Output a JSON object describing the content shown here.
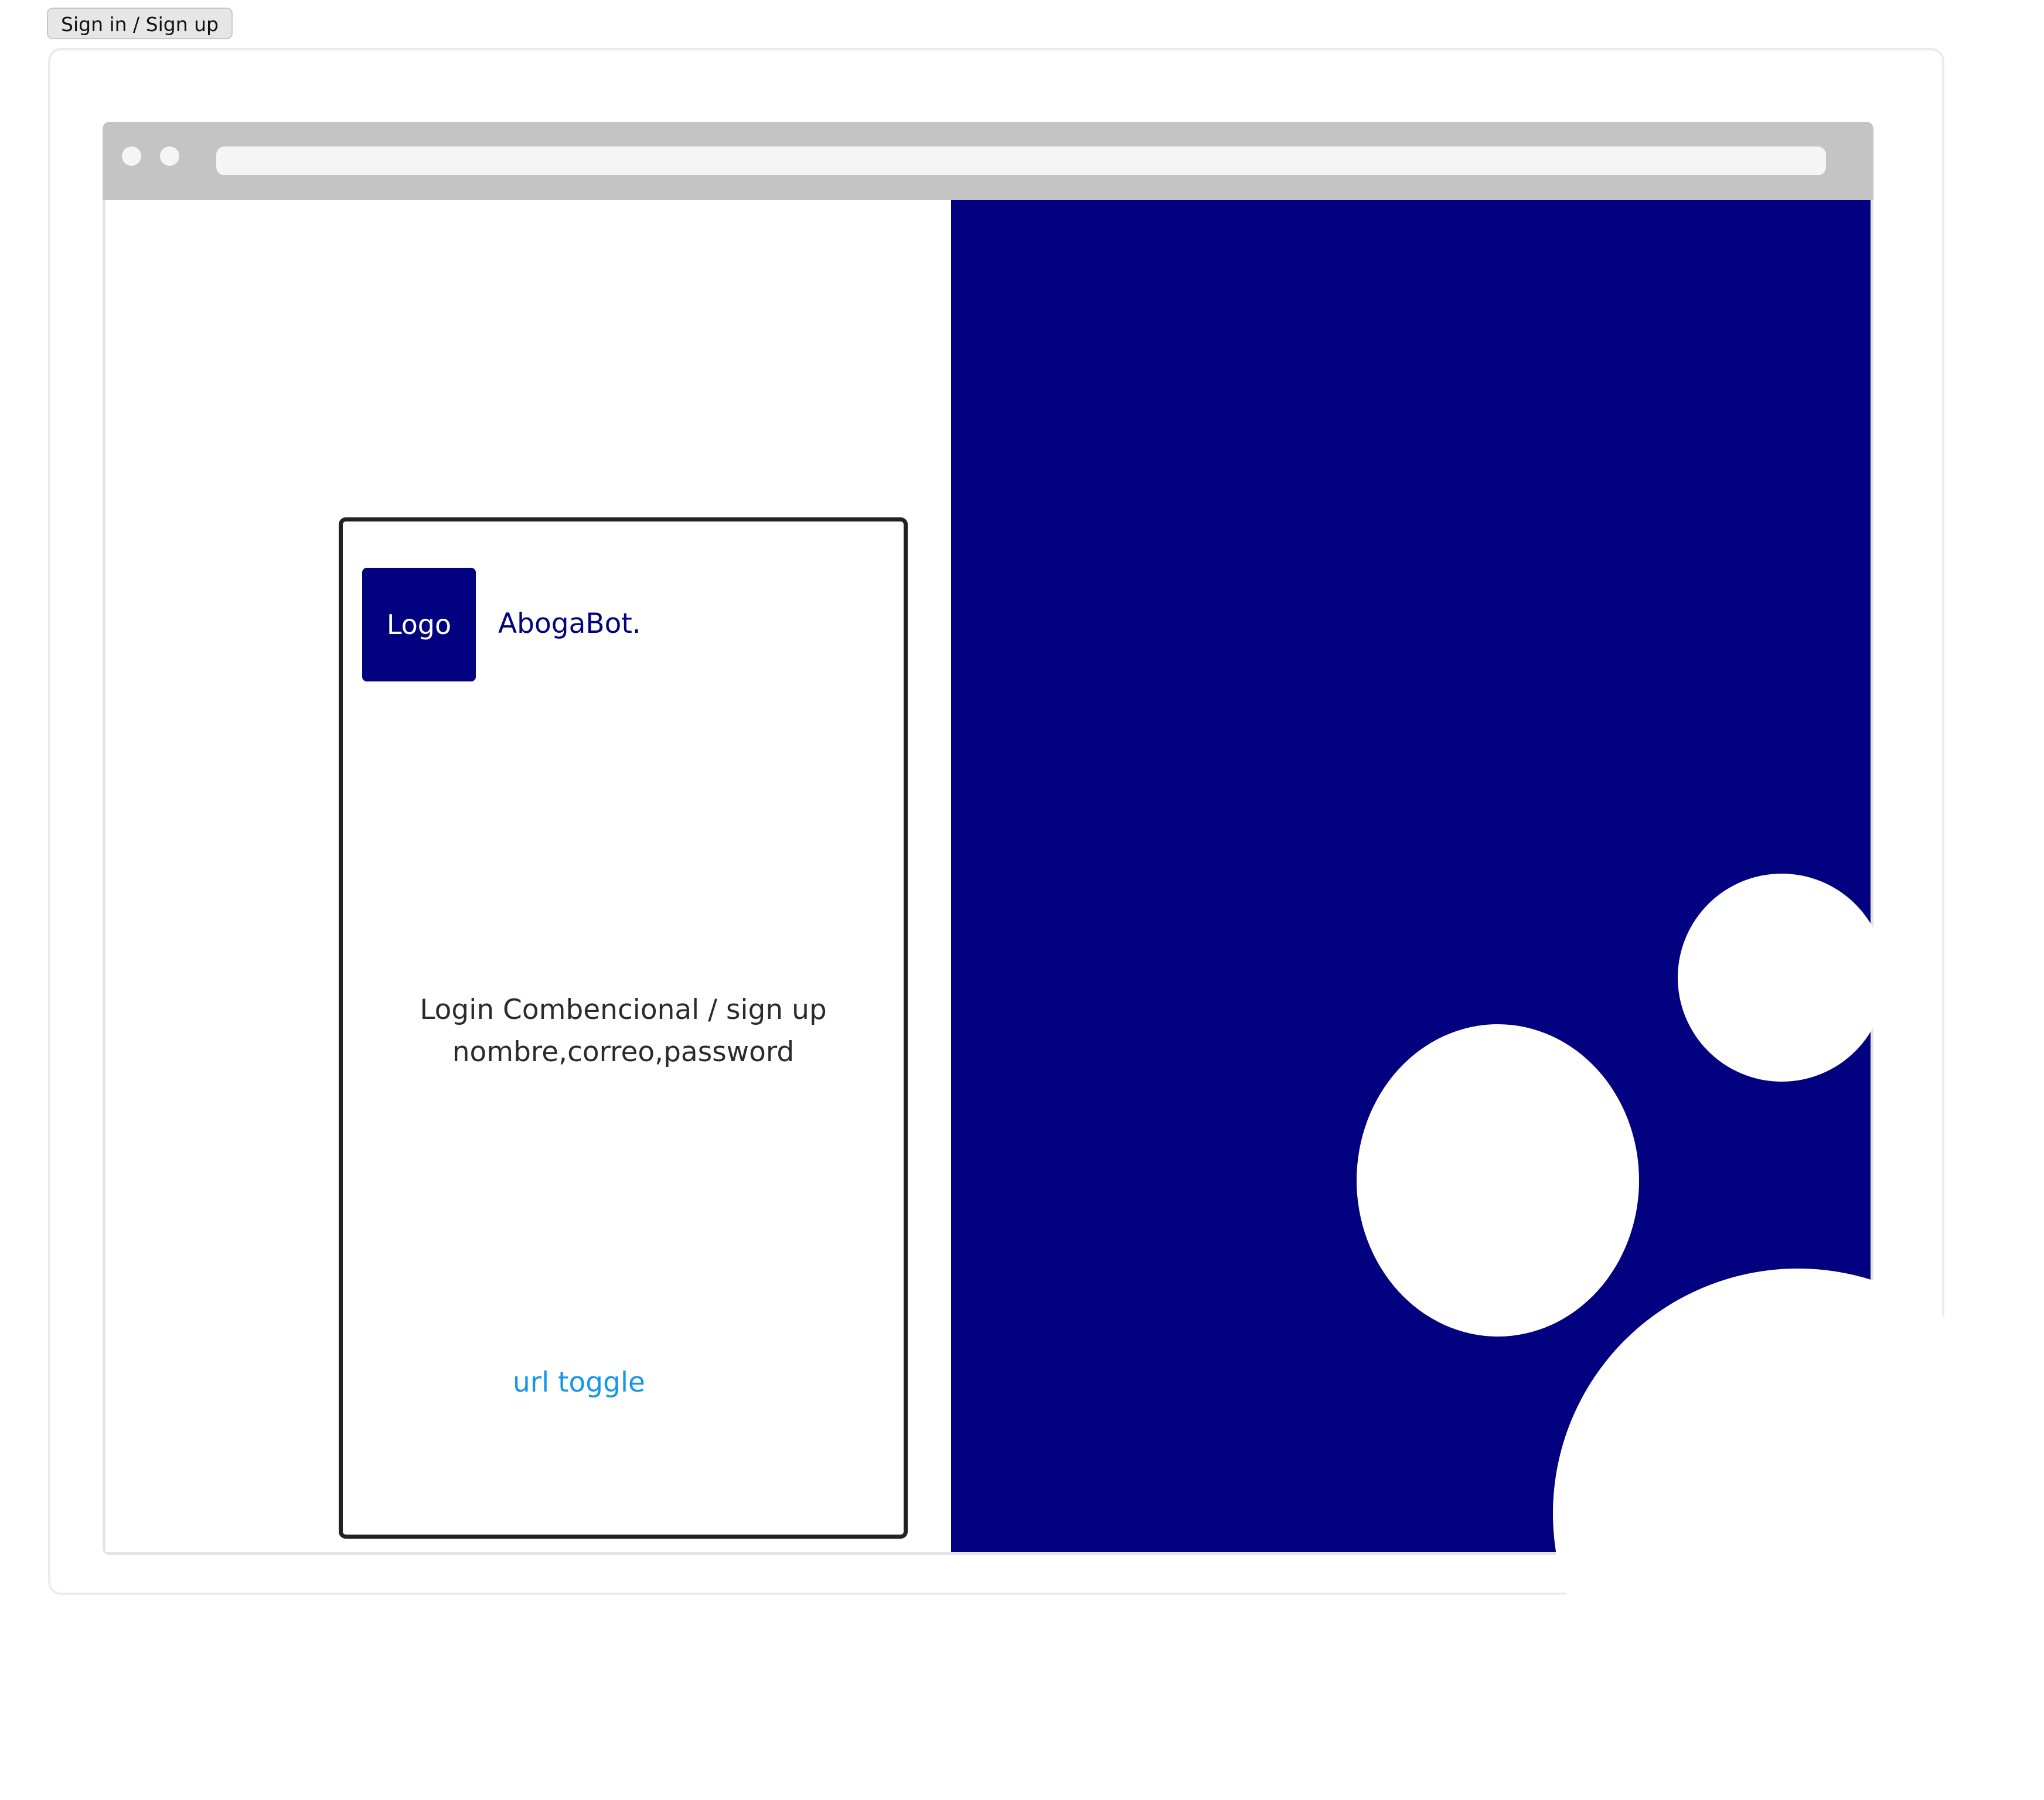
{
  "frame_tab": {
    "label": "Sign in / Sign up"
  },
  "login_card": {
    "logo_label": "Logo",
    "brand_name": "AbogaBot.",
    "form_line_1": "Login Combencional / sign up",
    "form_line_2": "nombre,correo,password",
    "toggle_link": "url toggle"
  },
  "colors": {
    "brand_navy": "#020280",
    "link_blue": "#1596e8",
    "browser_bar": "#c4c4c4",
    "text_dark": "#2b2b2b"
  }
}
